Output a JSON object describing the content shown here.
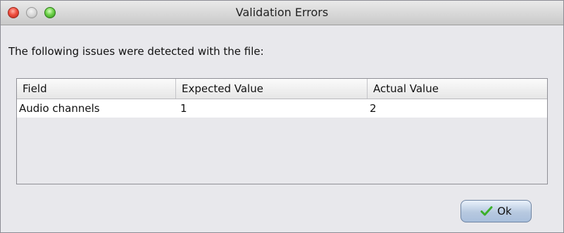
{
  "window": {
    "title": "Validation Errors"
  },
  "message": "The following issues were detected with the file:",
  "table": {
    "columns": [
      "Field",
      "Expected Value",
      "Actual Value"
    ],
    "rows": [
      [
        "Audio channels",
        "1",
        "2"
      ]
    ]
  },
  "ok_button": {
    "label": "Ok",
    "icon": "check-icon",
    "icon_color": "#3bb02a"
  }
}
